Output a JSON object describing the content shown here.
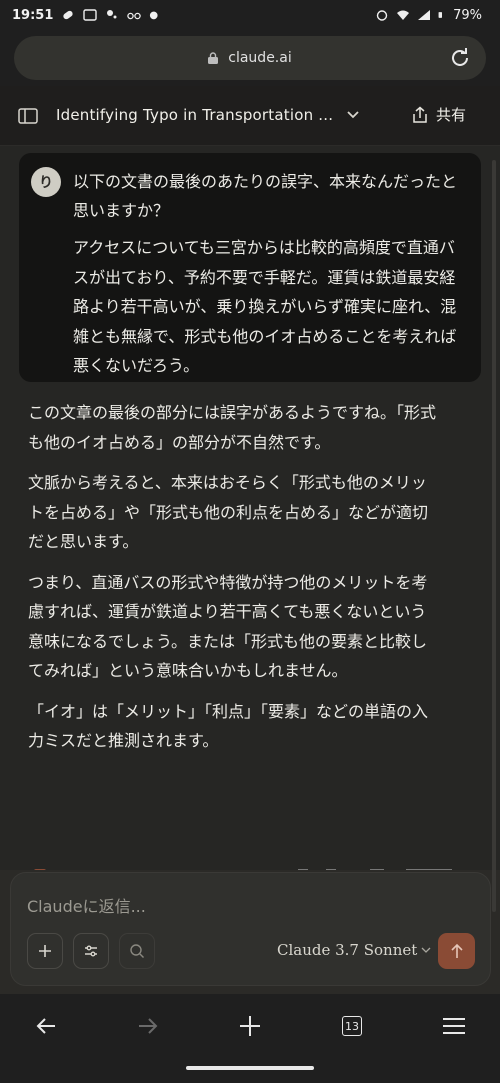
{
  "status": {
    "time": "19:51",
    "battery": "79%"
  },
  "browser": {
    "url": "claude.ai",
    "tab_count": "13"
  },
  "header": {
    "title": "Identifying Typo in Transportation ...",
    "share_label": "共有"
  },
  "user_message": {
    "avatar_initial": "り",
    "question": "以下の文書の最後のあたりの誤字、本来なんだったと思いますか？",
    "quote": "アクセスについても三宮からは比較的高頻度で直通バスが出ており、予約不要で手軽だ。運賃は鉄道最安経路より若干高いが、乗り換えがいらず確実に座れ、混雑とも無縁で、形式も他のイオ占めることを考えれば悪くないだろう。"
  },
  "reply": {
    "paragraphs": [
      "この文章の最後の部分には誤字があるようですね。「形式も他のイオ占める」の部分が不自然です。",
      "文脈から考えると、本来はおそらく「形式も他のメリットを占める」や「形式も他の利点を占める」などが適切だと思います。",
      "つまり、直通バスの形式や特徴が持つ他のメリットを考慮すれば、運賃が鉄道より若干高くても悪くないという意味になるでしょう。または「形式も他の要素と比較してみれば」という意味合いかもしれません。",
      "「イオ」は「メリット」「利点」「要素」などの単語の入力ミスだと推測されます。"
    ]
  },
  "composer": {
    "placeholder": "Claudeに返信...",
    "model": "Claude 3.7 Sonnet"
  },
  "colors": {
    "accent": "#8a4b35",
    "background": "#262624",
    "user_bubble": "#141413"
  },
  "icons": [
    "wifi-icon",
    "signal-icon",
    "battery-icon",
    "alarm-icon",
    "lock-icon",
    "reload-icon",
    "sidebar-icon",
    "chevron-down-icon",
    "share-icon",
    "plus-icon",
    "sliders-icon",
    "search-icon",
    "arrow-up-icon",
    "back-arrow-icon",
    "forward-arrow-icon",
    "menu-icon"
  ]
}
